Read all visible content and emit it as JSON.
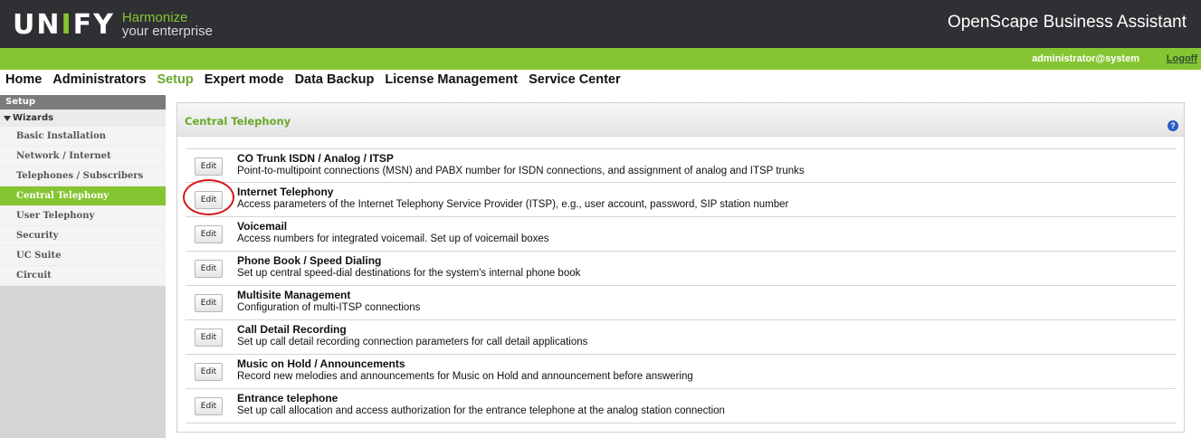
{
  "header": {
    "logo": "UNIFY",
    "tagline_line1": "Harmonize",
    "tagline_line2": "your enterprise",
    "app_title": "OpenScape Business Assistant"
  },
  "userbar": {
    "user": "administrator@system",
    "logoff": "Logoff"
  },
  "topnav": [
    "Home",
    "Administrators",
    "Setup",
    "Expert mode",
    "Data Backup",
    "License Management",
    "Service Center"
  ],
  "topnav_active": "Setup",
  "sidebar": {
    "title": "Setup",
    "group": "Wizards",
    "items": [
      "Basic Installation",
      "Network / Internet",
      "Telephones / Subscribers",
      "Central Telephony",
      "User Telephony",
      "Security",
      "UC Suite",
      "Circuit"
    ],
    "active": "Central Telephony"
  },
  "panel": {
    "title": "Central Telephony",
    "help_icon": "?",
    "edit_label": "Edit",
    "rows": [
      {
        "title": "CO Trunk ISDN / Analog / ITSP",
        "desc": "Point-to-multipoint connections (MSN) and PABX number for ISDN connections, and assignment of analog and ITSP trunks"
      },
      {
        "title": "Internet Telephony",
        "desc": "Access parameters of the Internet Telephony Service Provider (ITSP), e.g., user account, password, SIP station number"
      },
      {
        "title": "Voicemail",
        "desc": "Access numbers for integrated voicemail. Set up of voicemail boxes"
      },
      {
        "title": "Phone Book / Speed Dialing",
        "desc": "Set up central speed-dial destinations for the system's internal phone book"
      },
      {
        "title": "Multisite Management",
        "desc": "Configuration of multi-ITSP connections"
      },
      {
        "title": "Call Detail Recording",
        "desc": "Set up call detail recording connection parameters for call detail applications"
      },
      {
        "title": "Music on Hold / Announcements",
        "desc": "Record new melodies and announcements for Music on Hold and announcement before answering"
      },
      {
        "title": "Entrance telephone",
        "desc": "Set up call allocation and access authorization for the entrance telephone at the analog station connection"
      }
    ]
  },
  "colors": {
    "brand_green": "#86c532",
    "header_dark": "#2f3033",
    "highlight_red": "#d81818"
  }
}
